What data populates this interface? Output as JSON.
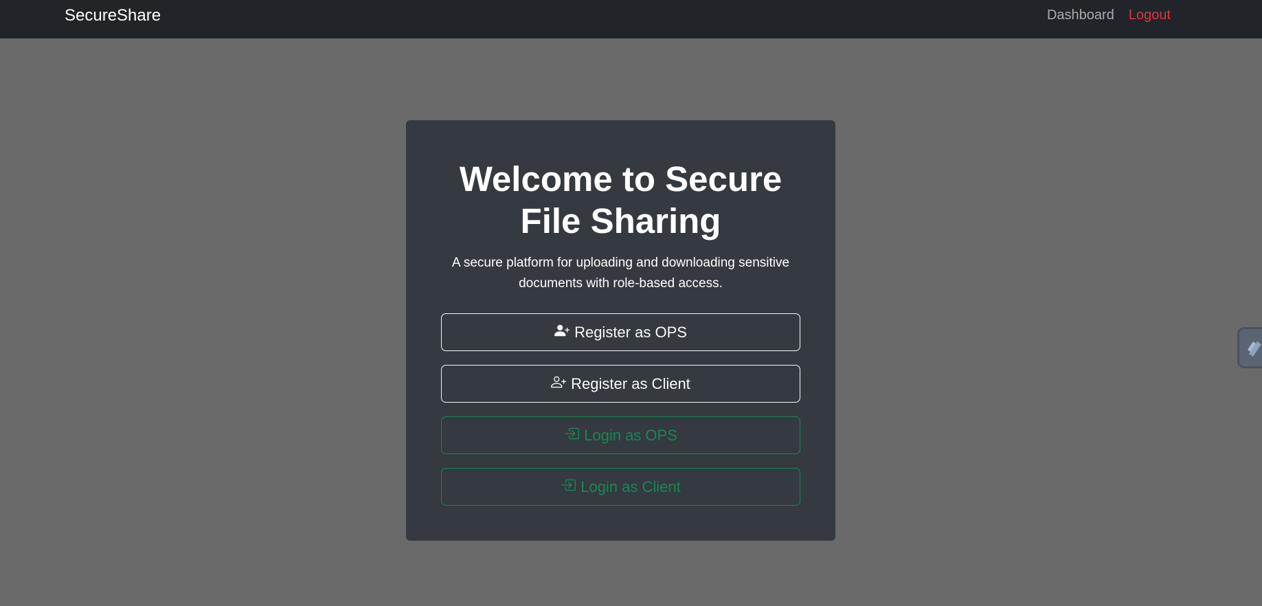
{
  "navbar": {
    "brand": "SecureShare",
    "links": {
      "dashboard": "Dashboard",
      "logout": "Logout"
    }
  },
  "card": {
    "title": "Welcome to Secure File Sharing",
    "subtitle": "A secure platform for uploading and downloading sensitive documents with role-based access.",
    "buttons": {
      "register_ops": {
        "label": "Register as OPS",
        "icon": "person-plus-fill-icon"
      },
      "register_client": {
        "label": "Register as Client",
        "icon": "person-plus-icon"
      },
      "login_ops": {
        "label": "Login as OPS",
        "icon": "box-arrow-in-right-icon"
      },
      "login_client": {
        "label": "Login as Client",
        "icon": "box-arrow-in-right-icon"
      }
    }
  },
  "colors": {
    "page_bg": "#6a6a6a",
    "navbar_bg": "#212529",
    "card_bg": "#343a40",
    "danger": "#dc3545",
    "success": "#198754",
    "light": "#f8f9fa"
  }
}
